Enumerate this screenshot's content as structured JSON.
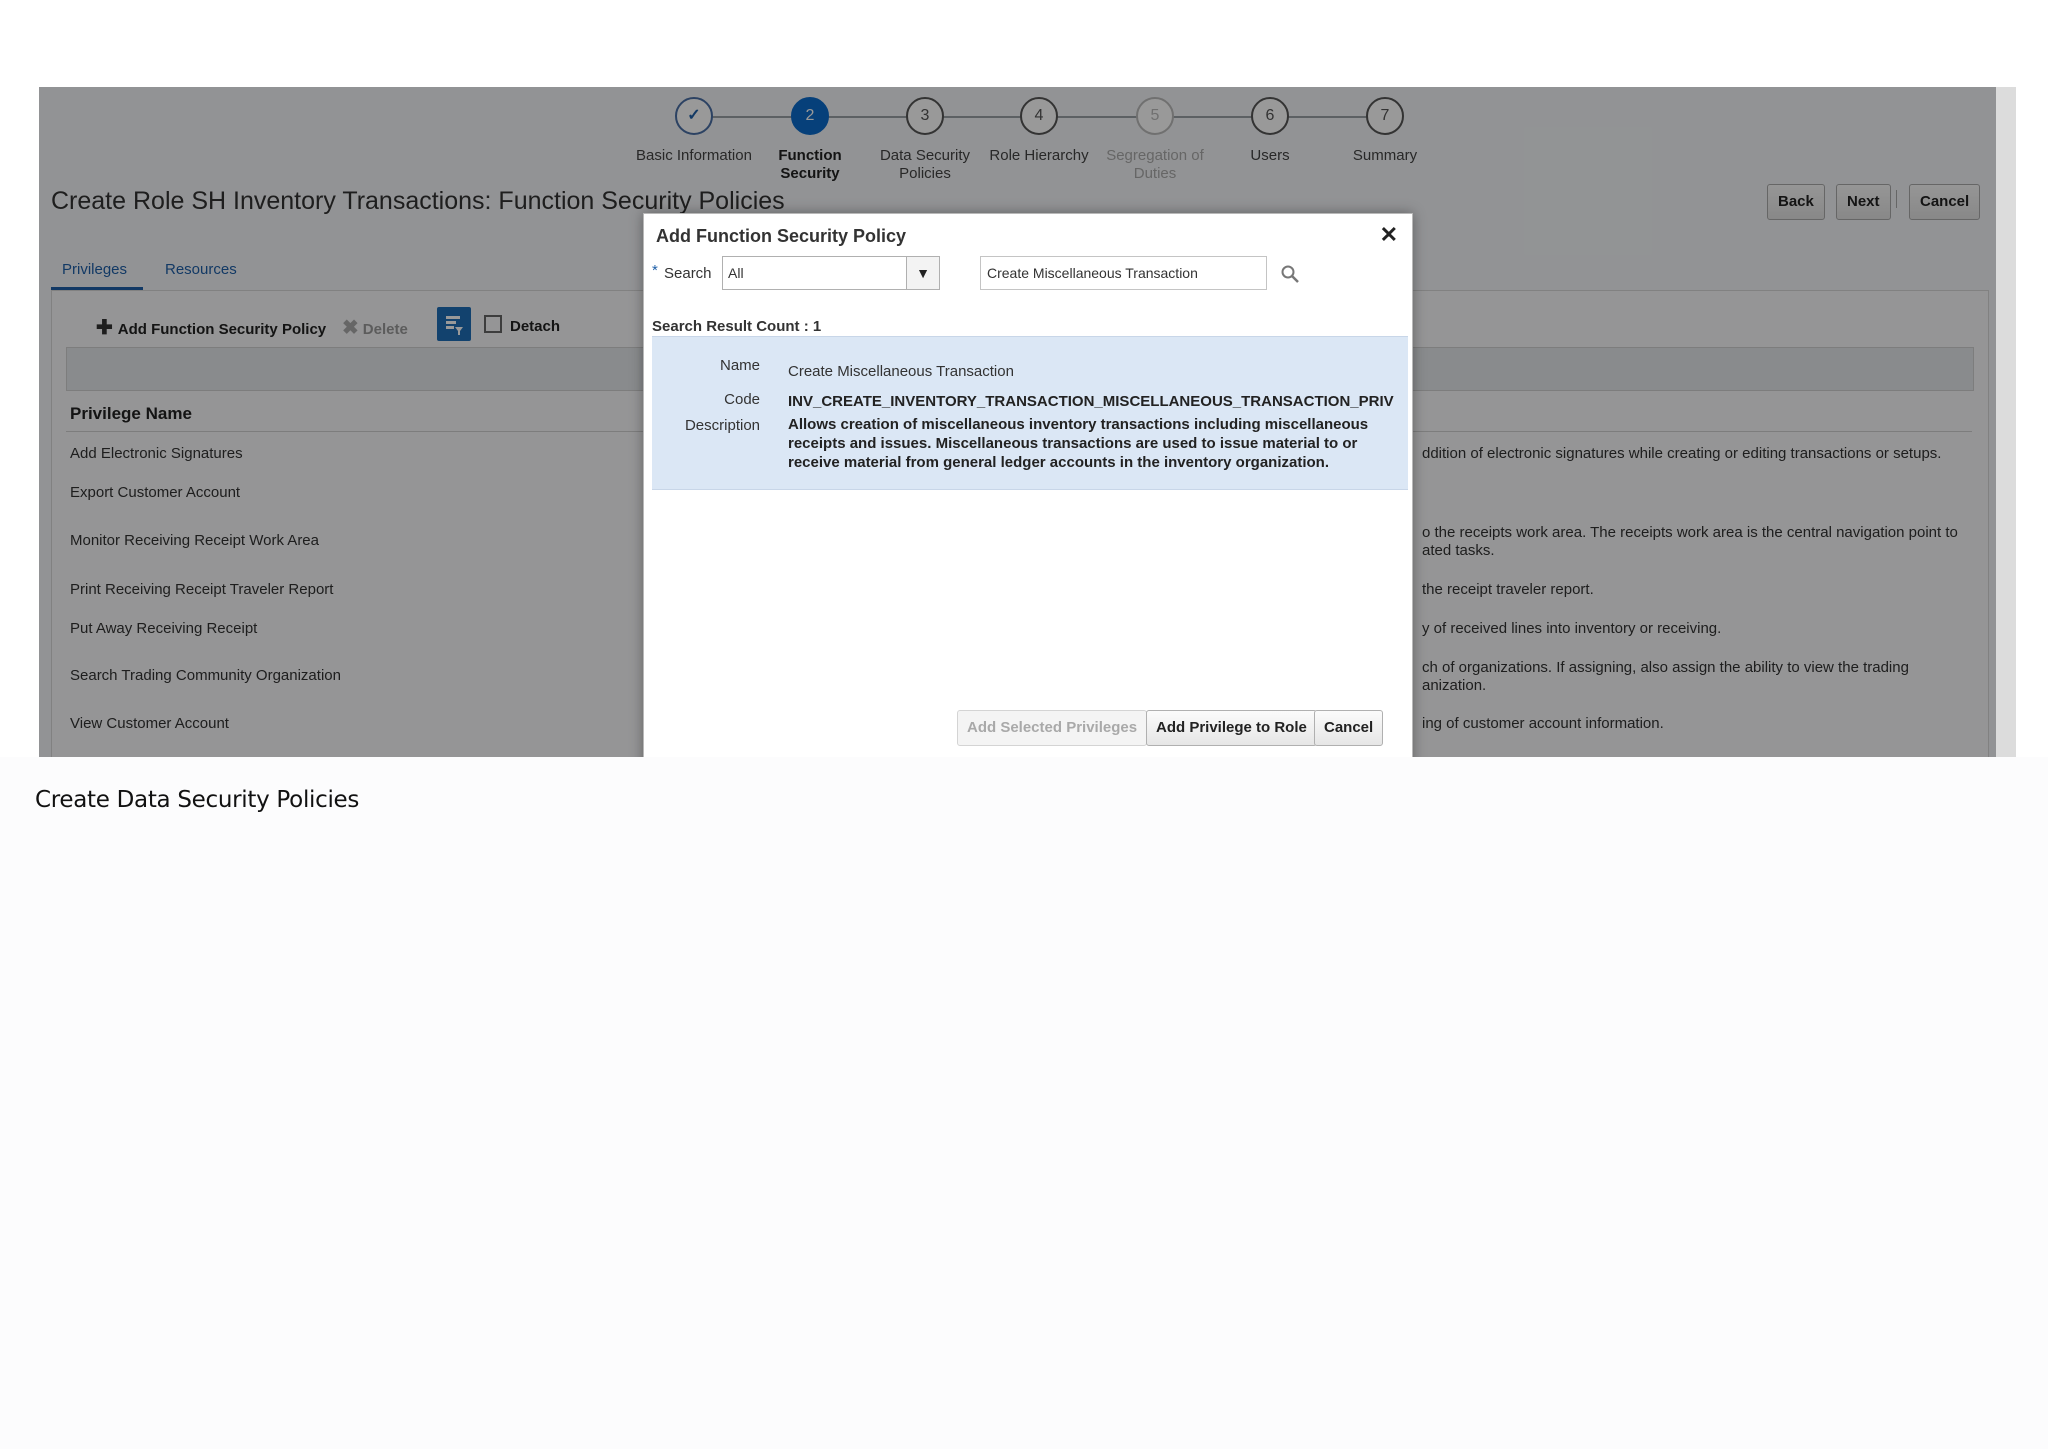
{
  "train": {
    "stops": [
      {
        "num": "✓",
        "label": "Basic Information",
        "state": "done"
      },
      {
        "num": "2",
        "label": "Function Security",
        "state": "active"
      },
      {
        "num": "3",
        "label": "Data Security Policies",
        "state": "normal"
      },
      {
        "num": "4",
        "label": "Role Hierarchy",
        "state": "normal"
      },
      {
        "num": "5",
        "label": "Segregation of Duties",
        "state": "disabled"
      },
      {
        "num": "6",
        "label": "Users",
        "state": "normal"
      },
      {
        "num": "7",
        "label": "Summary",
        "state": "normal"
      }
    ]
  },
  "page": {
    "title": "Create Role SH Inventory Transactions: Function Security Policies",
    "buttons": {
      "back": "Back",
      "next": "Next",
      "cancel": "Cancel"
    },
    "tabs": [
      "Privileges",
      "Resources"
    ],
    "toolbar": {
      "add": "Add Function Security Policy",
      "delete": "Delete",
      "detach": "Detach"
    },
    "column_header": "Privilege Name",
    "rows": [
      {
        "name": "Add Electronic Signatures",
        "desc": "ddition of electronic signatures while creating or editing transactions or setups."
      },
      {
        "name": "Export Customer Account",
        "desc": ""
      },
      {
        "name": "Monitor Receiving Receipt Work Area",
        "desc": "o the receipts work area. The receipts work area is the central navigation point to",
        "desc2": "ated tasks."
      },
      {
        "name": "Print Receiving Receipt Traveler Report",
        "desc": "the receipt traveler report."
      },
      {
        "name": "Put Away Receiving Receipt",
        "desc": "y of received lines into inventory or receiving."
      },
      {
        "name": "Search Trading Community Organization",
        "desc": "ch of organizations. If assigning, also assign the ability to view the trading",
        "desc2": "anization."
      },
      {
        "name": "View Customer Account",
        "desc": "ing of customer account information."
      }
    ]
  },
  "dialog": {
    "title": "Add Function Security Policy",
    "required_mark": "*",
    "search_label": "Search",
    "search_scope": "All",
    "search_text": "Create Miscellaneous Transaction",
    "result_count": "Search Result Count : 1",
    "result": {
      "name_label": "Name",
      "name": "Create Miscellaneous Transaction",
      "code_label": "Code",
      "code": "INV_CREATE_INVENTORY_TRANSACTION_MISCELLANEOUS_TRANSACTION_PRIV",
      "description_label": "Description",
      "description": "Allows creation of miscellaneous inventory transactions including miscellaneous receipts and issues. Miscellaneous transactions are used to issue material to or receive material from general ledger accounts in the inventory organization."
    },
    "buttons": {
      "add_selected": "Add Selected Privileges",
      "add_to_role": "Add Privilege to Role",
      "cancel": "Cancel"
    }
  },
  "caption": "Create Data Security Policies"
}
